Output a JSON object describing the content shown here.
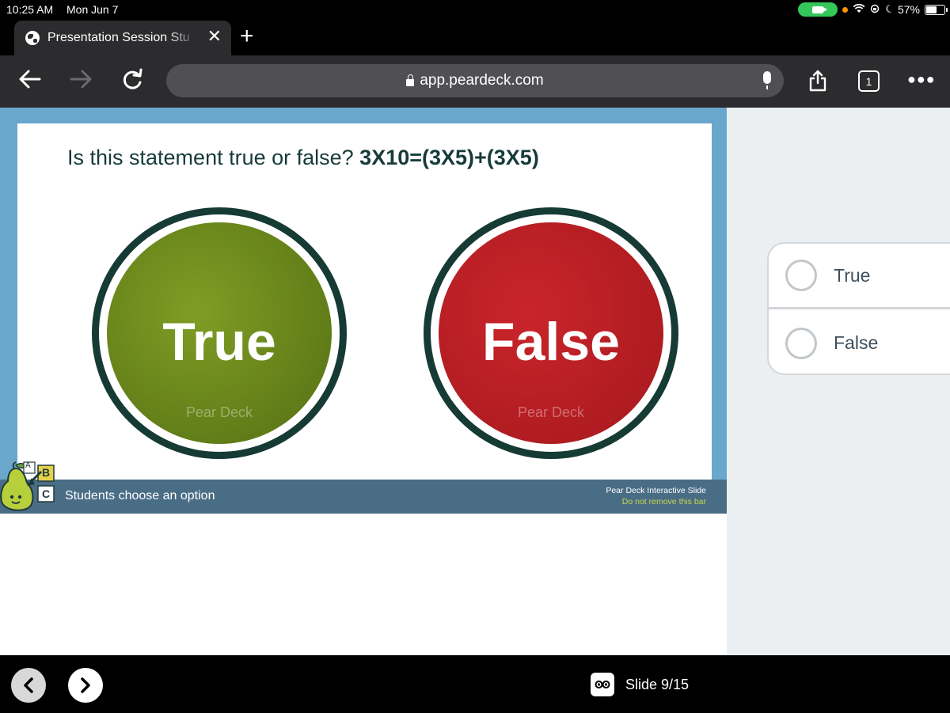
{
  "status_bar": {
    "time": "10:25 AM",
    "date": "Mon Jun 7",
    "battery": "57%",
    "battery_level": 0.57
  },
  "browser": {
    "tab_title": "Presentation Session Stu",
    "url": "app.peardeck.com",
    "tab_count": "1"
  },
  "slide": {
    "question_prefix": "Is this statement true or false? ",
    "question_equation": "3X10=(3X5)+(3X5)",
    "option_true": "True",
    "option_false": "False",
    "watermark": "Pear Deck",
    "bar_text": "Students choose an option",
    "bar_right_1": "Pear Deck Interactive Slide",
    "bar_right_2": "Do not remove this bar",
    "logo_letters": [
      "A",
      "B",
      "C"
    ]
  },
  "answers": [
    {
      "label": "True"
    },
    {
      "label": "False"
    }
  ],
  "bottom": {
    "slide_indicator": "Slide 9/15"
  },
  "colors": {
    "true_green": "#6e8c1f",
    "false_red": "#b81f24",
    "frame_blue": "#6aa7cc",
    "bar_slate": "#4a6d86"
  }
}
